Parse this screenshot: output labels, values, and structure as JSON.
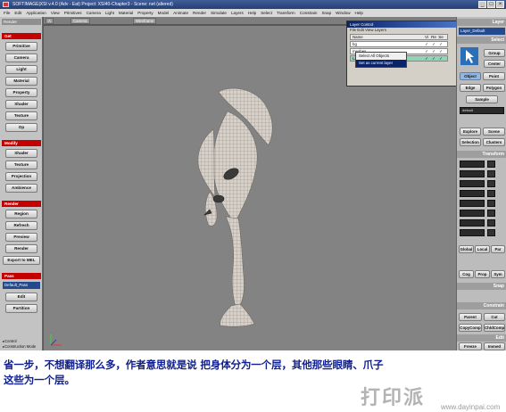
{
  "titlebar": {
    "title": "SOFTIMAGE|XSI v.4.0 (Adv - Eat) Project: XSI40-Chapter3 - Scene: net (altered)"
  },
  "menubar": {
    "items": [
      "File",
      "Edit",
      "Application",
      "View",
      "Primitives",
      "Camera",
      "Light",
      "Material",
      "Property",
      "Model",
      "Animate",
      "Render",
      "Simulate",
      "Layers",
      "Help",
      "Select",
      "Transform",
      "Constrain",
      "Snap",
      "Window",
      "Help"
    ]
  },
  "left_panel": {
    "mode_label": "Render",
    "section_get": "Get",
    "get_buttons": [
      "Primitive",
      "Camera",
      "Light",
      "Material",
      "Property",
      "Shader",
      "Texture",
      "Op"
    ],
    "section_modify": "Modify",
    "modify_buttons": [
      "Shader",
      "Texture",
      "Projection",
      "Ambience"
    ],
    "section_render": "Render",
    "render_buttons": [
      "Region",
      "Refresh",
      "Preview",
      "Render",
      "Export to MEL"
    ],
    "section_pass": "Pass",
    "pass_dropdown": "Default_Pass",
    "pass_buttons": [
      "Edit",
      "Partition"
    ],
    "status_items": [
      "▸Control",
      "▸Construction Mode"
    ]
  },
  "viewport": {
    "camera_label": "Camera",
    "view_mode": "Wireframe"
  },
  "layer_panel": {
    "title": "Layer Control",
    "menu": "File  Edit  View  Layers",
    "header": "Name",
    "rows": [
      "bg",
      "meshes",
      "Layer_Default"
    ],
    "flags_header": [
      "Vi",
      "Re",
      "Se"
    ]
  },
  "context_menu": {
    "items": [
      "Select All Objects",
      "Set as current layer"
    ]
  },
  "right_panel": {
    "header": "Layer",
    "layer_dropdown": "Layer_Default",
    "select_header": "Select",
    "buttons_top": [
      "Group",
      "Center"
    ],
    "object_button": "Object",
    "point_button": "Point",
    "edge_button": "Edge",
    "polygon_button": "Polygon",
    "sample_button": "Sample",
    "selected_field": "default",
    "explore_button": "Explore",
    "scene_button": "Scene",
    "selection_button": "Selection",
    "clusters_button": "Clusters",
    "transform_header": "Transform",
    "transform_fields": [
      "",
      "",
      "",
      "",
      "",
      "",
      "",
      ""
    ],
    "global_buttons": [
      "Global",
      "Local",
      "Par"
    ],
    "snap_buttons": [
      "Cog",
      "Prop",
      "Sym"
    ],
    "snap_header": "Snap",
    "constrain_header": "Constrain",
    "parent_button": "Parent",
    "cut_button": "Cut",
    "copycomp_button": "CopyComp",
    "childcomp_button": "ChldComp",
    "edit_header": "Edit",
    "freeze_button": "Freeze",
    "immed_button": "Immed"
  },
  "caption": {
    "line1": "省一步，不想翻译那么多，作者意思就是说 把身体分为一个层，其他那些眼睛、爪子",
    "line2": "这些为一个层。"
  },
  "watermark": {
    "main": "打印派",
    "sub": "www.dayinpai.com"
  }
}
